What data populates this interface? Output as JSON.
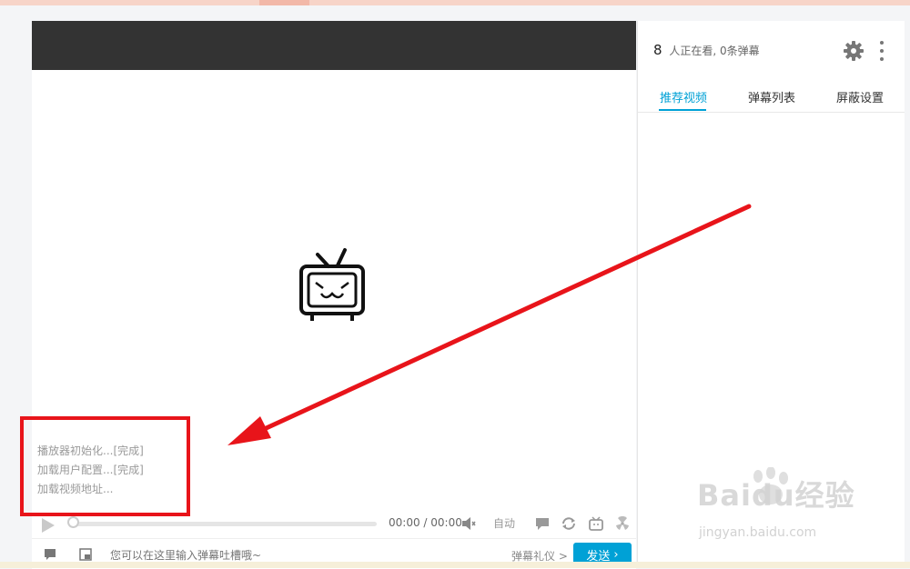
{
  "player": {
    "init_log": [
      "播放器初始化...[完成]",
      "加载用户配置...[完成]",
      "加载视频地址..."
    ],
    "time_display": "00:00 / 00:00",
    "quality_label": "自动",
    "progress": 0,
    "danmaku_placeholder": "您可以在这里输入弹幕吐槽哦~",
    "etiquette_label": "弹幕礼仪 >",
    "send_label": "发送",
    "send_chevron": "›"
  },
  "side_panel": {
    "viewer_count": "8",
    "viewer_text": "人正在看, 0条弹幕",
    "tabs": [
      {
        "label": "推荐视频",
        "active": true
      },
      {
        "label": "弹幕列表",
        "active": false
      },
      {
        "label": "屏蔽设置",
        "active": false
      }
    ]
  },
  "watermark": {
    "title": "Baidu经验",
    "url": "jingyan.baidu.com"
  },
  "icons": {
    "logo": "bilibili-tv-icon",
    "play": "play-icon",
    "volume": "volume-muted-icon",
    "gear": "gear-icon",
    "more": "more-vertical-icon"
  },
  "colors": {
    "accent": "#00a1d6",
    "annotation": "#e8141a",
    "player_header": "#333333"
  }
}
